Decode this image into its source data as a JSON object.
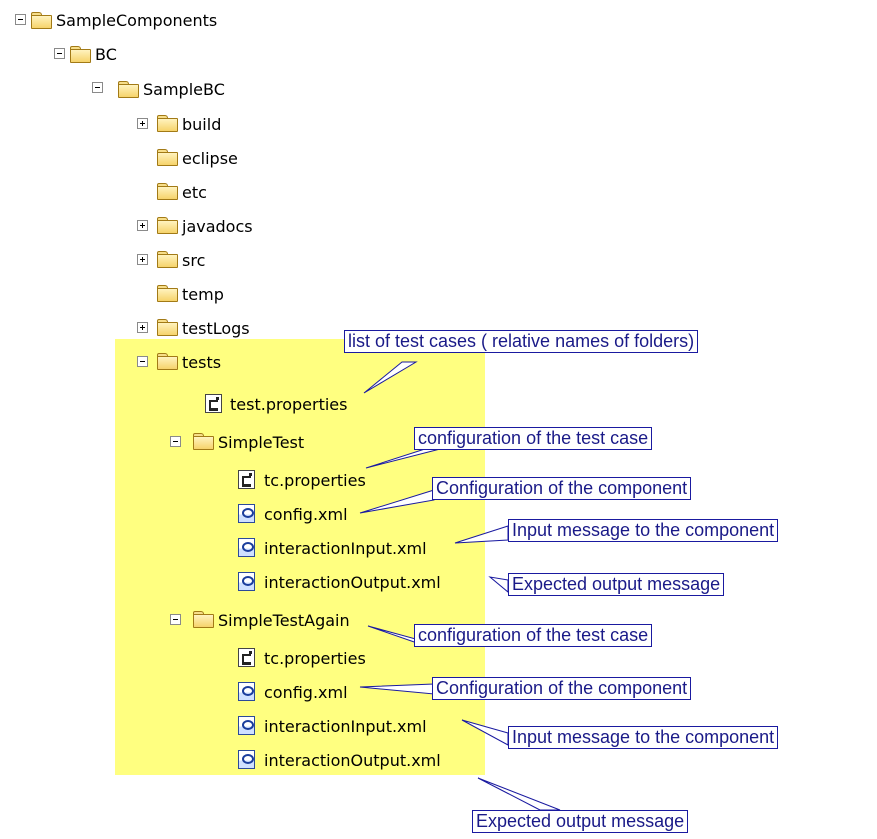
{
  "tree": {
    "root": "SampleComponents",
    "bc": "BC",
    "samplebc": "SampleBC",
    "build": "build",
    "eclipse": "eclipse",
    "etc": "etc",
    "javadocs": "javadocs",
    "src": "src",
    "temp": "temp",
    "testlogs": "testLogs",
    "tests": "tests",
    "test_properties": "test.properties",
    "simpletest": {
      "name": "SimpleTest",
      "tc_properties": "tc.properties",
      "config": "config.xml",
      "input": "interactionInput.xml",
      "output": "interactionOutput.xml"
    },
    "simpletestagain": {
      "name": "SimpleTestAgain",
      "tc_properties": "tc.properties",
      "config": "config.xml",
      "input": "interactionInput.xml",
      "output": "interactionOutput.xml"
    }
  },
  "callouts": {
    "test_list": "list of test cases ( relative names of folders)",
    "tc_config_1": "configuration of the test case",
    "comp_config_1": "Configuration of the component",
    "input_1": "Input message to the component",
    "output_1": "Expected output message",
    "tc_config_2": "configuration of the test case",
    "comp_config_2": "Configuration of the component",
    "input_2": "Input message to the component",
    "output_2": "Expected output message"
  },
  "colors": {
    "highlight": "#ffff80",
    "callout_border": "#1a1aa0",
    "callout_text": "#1a1a88"
  }
}
